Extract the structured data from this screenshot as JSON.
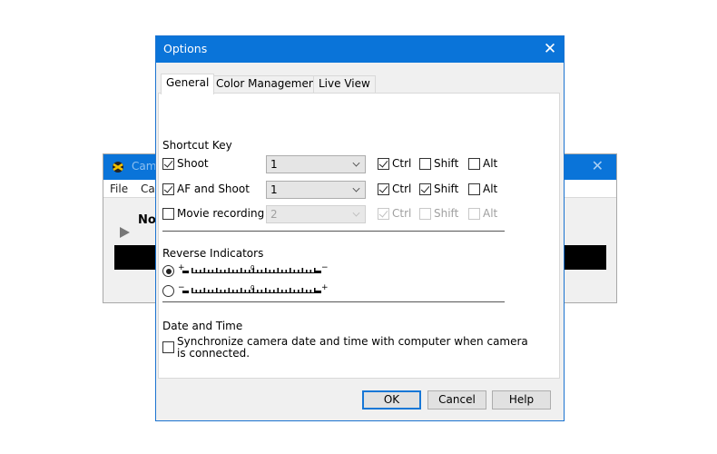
{
  "background_window": {
    "title": "Cam",
    "menu": [
      "File",
      "Ca"
    ],
    "status_text": "No",
    "accent_color": "#0a74d9"
  },
  "dialog": {
    "title": "Options",
    "close_symbol": "✕",
    "tabs": [
      {
        "label": "General",
        "active": true
      },
      {
        "label": "Color Management",
        "active": false
      },
      {
        "label": "Live View",
        "active": false
      }
    ],
    "shortcut_key": {
      "heading": "Shortcut Key",
      "rows": [
        {
          "label": "Shoot",
          "checked": true,
          "enabled": true,
          "value": "1",
          "ctrl": true,
          "shift": false,
          "alt": false
        },
        {
          "label": "AF and Shoot",
          "checked": true,
          "enabled": true,
          "value": "1",
          "ctrl": true,
          "shift": true,
          "alt": false
        },
        {
          "label": "Movie recording",
          "checked": false,
          "enabled": false,
          "value": "2",
          "ctrl": true,
          "shift": false,
          "alt": false
        }
      ],
      "modifier_labels": {
        "ctrl": "Ctrl",
        "shift": "Shift",
        "alt": "Alt"
      }
    },
    "reverse_indicators": {
      "heading": "Reverse Indicators",
      "options": [
        {
          "left_sign": "+",
          "right_sign": "−",
          "zero_label": "0",
          "selected": true
        },
        {
          "left_sign": "−",
          "right_sign": "+",
          "zero_label": "0",
          "selected": false
        }
      ]
    },
    "date_time": {
      "heading": "Date and Time",
      "sync_label_line1": "Synchronize camera date and time with computer when camera",
      "sync_label_line2": "is connected.",
      "sync_checked": false
    },
    "buttons": {
      "ok": "OK",
      "cancel": "Cancel",
      "help": "Help"
    }
  }
}
